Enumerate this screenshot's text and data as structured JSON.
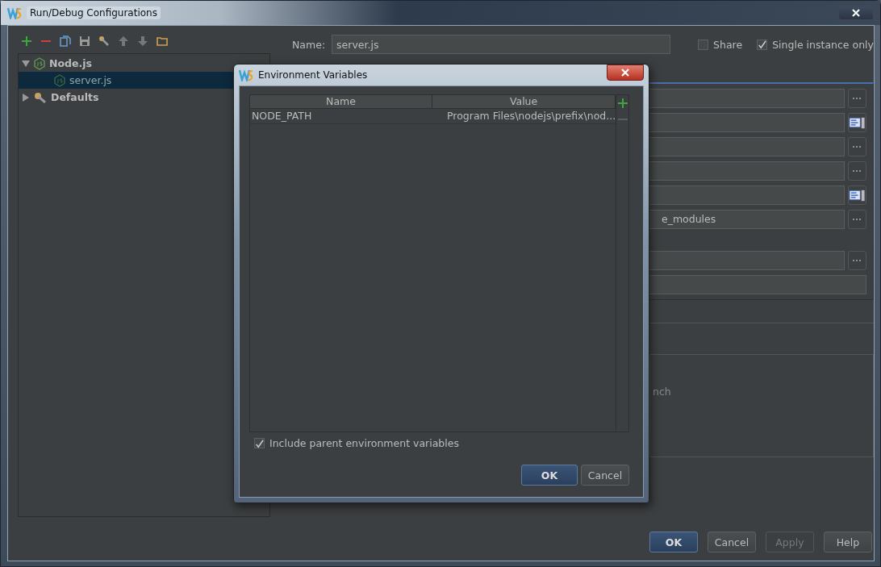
{
  "window": {
    "title": "Run/Debug Configurations"
  },
  "tree": [
    {
      "label": "Node.js",
      "expanded": true,
      "selected": false,
      "children": [
        {
          "label": "server.js",
          "selected": true
        }
      ]
    },
    {
      "label": "Defaults",
      "expanded": false,
      "selected": false
    }
  ],
  "name_field": {
    "label": "Name:",
    "value": "server.js"
  },
  "options": [
    {
      "label": "Share",
      "checked": false
    },
    {
      "label": "Single instance only",
      "checked": true
    }
  ],
  "config_fields": [
    {
      "kind": "browse"
    },
    {
      "kind": "edit"
    },
    {
      "kind": "browse"
    },
    {
      "kind": "browse"
    },
    {
      "kind": "edit"
    },
    {
      "kind": "browse",
      "value": "e_modules"
    },
    {
      "kind": "browse"
    },
    {
      "kind": "plain"
    }
  ],
  "group_text": "nch",
  "buttons": [
    {
      "label": "OK",
      "primary": true,
      "disabled": false
    },
    {
      "label": "Cancel",
      "primary": false,
      "disabled": false
    },
    {
      "label": "Apply",
      "primary": false,
      "disabled": true
    },
    {
      "label": "Help",
      "primary": false,
      "disabled": false
    }
  ],
  "dialog": {
    "title": "Environment Variables",
    "columns": [
      "Name",
      "Value"
    ],
    "rows": [
      {
        "cells": [
          "NODE_PATH",
          "Program Files\\nodejs\\prefix\\nod..."
        ]
      }
    ],
    "include_parent": {
      "label": "Include parent environment variables",
      "checked": true
    },
    "buttons": [
      {
        "label": "OK",
        "primary": true
      },
      {
        "label": "Cancel",
        "primary": false
      }
    ]
  }
}
